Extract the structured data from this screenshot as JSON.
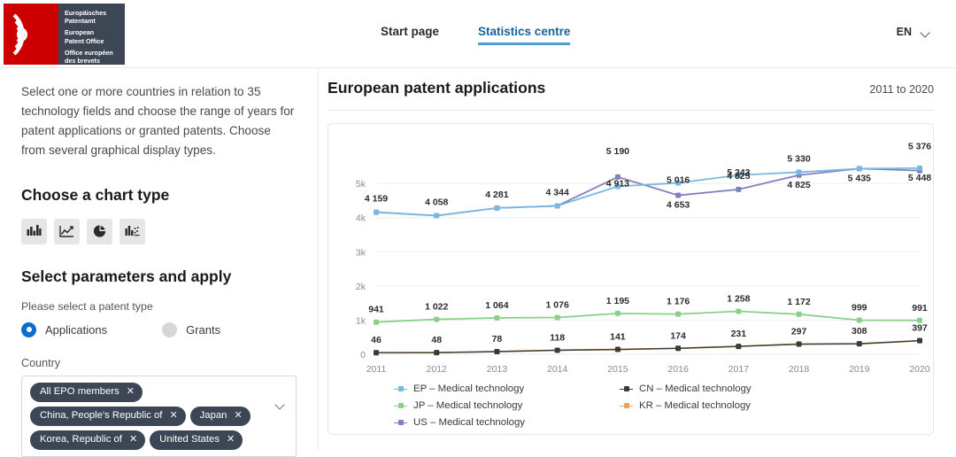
{
  "header": {
    "logo": {
      "line_de": "Europäisches Patentamt",
      "line_en": "European Patent Office",
      "line_fr": "Office européen des brevets",
      "de_1": "Europäisches",
      "de_2": "Patentamt",
      "en_1": "European",
      "en_2": "Patent Office",
      "fr_1": "Office européen",
      "fr_2": "des brevets"
    },
    "nav": [
      {
        "label": "Start page",
        "active": false
      },
      {
        "label": "Statistics centre",
        "active": true
      }
    ],
    "language": "EN"
  },
  "sidebar": {
    "intro": "Select one or more countries in relation to 35 technology fields and choose the range of years for patent applications or granted patents. Choose from several graphical display types.",
    "chart_type_heading": "Choose a chart type",
    "chart_types": [
      {
        "name": "bar-chart-icon",
        "selected": true
      },
      {
        "name": "line-chart-icon",
        "selected": false
      },
      {
        "name": "pie-chart-icon",
        "selected": false
      },
      {
        "name": "mixed-chart-icon",
        "selected": false
      }
    ],
    "parameters_heading": "Select parameters and apply",
    "patent_type_label": "Please select a patent type",
    "patent_types": [
      {
        "label": "Applications",
        "selected": true
      },
      {
        "label": "Grants",
        "selected": false
      }
    ],
    "country_label": "Country",
    "country_chips": [
      "All EPO members",
      "China, People's Republic of",
      "Japan",
      "Korea, Republic of",
      "United States"
    ],
    "chip_remove_glyph": "✕"
  },
  "main": {
    "title": "European patent applications",
    "range": "2011 to 2020"
  },
  "chart_data": {
    "type": "line",
    "title": "European patent applications",
    "subtitle": "2011 to 2020",
    "xlabel": "",
    "ylabel": "",
    "categories": [
      "2011",
      "2012",
      "2013",
      "2014",
      "2015",
      "2016",
      "2017",
      "2018",
      "2019",
      "2020"
    ],
    "ylim": [
      0,
      5600
    ],
    "yticks": [
      0,
      1000,
      2000,
      3000,
      4000,
      5000
    ],
    "ytick_labels": [
      "0",
      "1k",
      "2k",
      "3k",
      "4k",
      "5k"
    ],
    "grid": true,
    "legend_position": "bottom",
    "series": [
      {
        "name": "EP – Medical technology",
        "code": "EP",
        "color": "#7ab8e0",
        "values": [
          4159,
          4058,
          4281,
          4344,
          4913,
          5016,
          5243,
          5330,
          5435,
          5448
        ],
        "labels": [
          "4 159",
          "4 058",
          "4 281",
          "4 344",
          "4 913",
          "5 016",
          "5 243",
          "5 330",
          "5 435",
          "5 448"
        ]
      },
      {
        "name": "CN – Medical technology",
        "code": "CN",
        "color": "#3a3a3a",
        "values": [
          46,
          48,
          78,
          118,
          141,
          174,
          231,
          297,
          308,
          397
        ],
        "labels": [
          "46",
          "48",
          "78",
          "118",
          "141",
          "174",
          "231",
          "297",
          "308",
          "397"
        ]
      },
      {
        "name": "JP – Medical technology",
        "code": "JP",
        "color": "#8ad08a",
        "values": [
          941,
          1022,
          1064,
          1076,
          1195,
          1176,
          1258,
          1172,
          999,
          991
        ],
        "labels": [
          "941",
          "1 022",
          "1 064",
          "1 076",
          "1 195",
          "1 176",
          "1 258",
          "1 172",
          "999",
          "991"
        ]
      },
      {
        "name": "KR – Medical technology",
        "code": "KR",
        "color": "#e8a55c",
        "values": [
          46,
          48,
          78,
          118,
          141,
          174,
          231,
          297,
          308,
          397
        ],
        "labels": []
      },
      {
        "name": "US – Medical technology",
        "code": "US",
        "color": "#8080c0",
        "values": [
          4159,
          4058,
          4281,
          4344,
          5190,
          4653,
          4825,
          5243,
          5435,
          5376
        ],
        "labels": [
          "",
          "",
          "",
          "",
          "5 190",
          "4 653",
          "4 825",
          "5 330",
          "",
          "5 376"
        ]
      }
    ],
    "point_labels_top": [
      {
        "x": "2011",
        "text": "4 159"
      },
      {
        "x": "2012",
        "text": "4 058"
      },
      {
        "x": "2013",
        "text": "4 281"
      },
      {
        "x": "2014",
        "text": "4 344"
      },
      {
        "x": "2015",
        "text": "5 190"
      },
      {
        "x": "2015",
        "text": "4 913"
      },
      {
        "x": "2016",
        "text": "5 016"
      },
      {
        "x": "2016",
        "text": "4 653"
      },
      {
        "x": "2017",
        "text": "5 243"
      },
      {
        "x": "2017",
        "text": "4 825"
      },
      {
        "x": "2018",
        "text": "5 330"
      },
      {
        "x": "2019",
        "text": "5 435"
      },
      {
        "x": "2020",
        "text": "5 376"
      },
      {
        "x": "2020",
        "text": "5 448"
      }
    ]
  },
  "colors": {
    "brand_red": "#cc0000",
    "brand_dark": "#3d4654",
    "accent_blue": "#0a6ed1",
    "link_blue": "#18639c"
  }
}
